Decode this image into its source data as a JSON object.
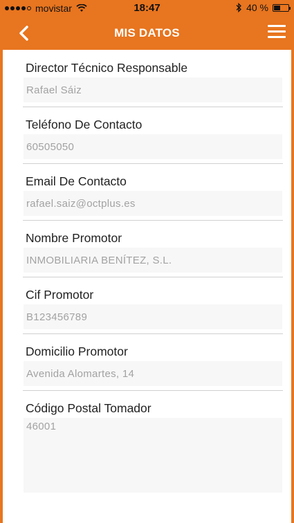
{
  "status_bar": {
    "carrier": "movistar",
    "time": "18:47",
    "battery": "40 %"
  },
  "nav": {
    "title": "MIS DATOS"
  },
  "fields": [
    {
      "label": "Director Técnico Responsable",
      "value": "Rafael Sáiz"
    },
    {
      "label": "Teléfono De Contacto",
      "value": "60505050"
    },
    {
      "label": "Email De Contacto",
      "value": "rafael.saiz@octplus.es"
    },
    {
      "label": "Nombre Promotor",
      "value": "INMOBILIARIA BENÍTEZ, S.L."
    },
    {
      "label": "Cif Promotor",
      "value": "B123456789"
    },
    {
      "label": "Domicilio Promotor",
      "value": "Avenida Alomartes, 14"
    },
    {
      "label": "Código Postal Tomador",
      "value": "46001"
    }
  ],
  "colors": {
    "accent": "#e8751f",
    "value_text": "#a2a2a2",
    "field_bg": "#f7f7f7"
  }
}
